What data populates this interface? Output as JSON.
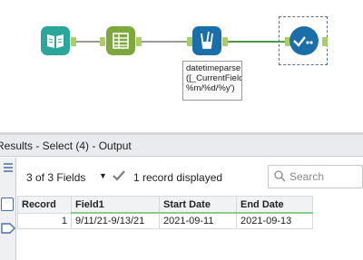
{
  "canvas": {
    "annotation": "datetimeparse\n([_CurrentField_],'\n%m/%d/%y')",
    "tools": [
      "book-icon",
      "text-to-columns-icon",
      "formula-icon",
      "select-check-icon"
    ]
  },
  "results": {
    "title": "Results - Select (4) - Output",
    "fields_label": "3 of 3 Fields",
    "records_label": "1 record displayed",
    "search_placeholder": "Search",
    "columns": [
      "Record",
      "Field1",
      "Start Date",
      "End Date"
    ],
    "rows": [
      [
        "1",
        "9/11/21-9/13/21",
        "2021-09-11",
        "2021-09-13"
      ]
    ]
  }
}
